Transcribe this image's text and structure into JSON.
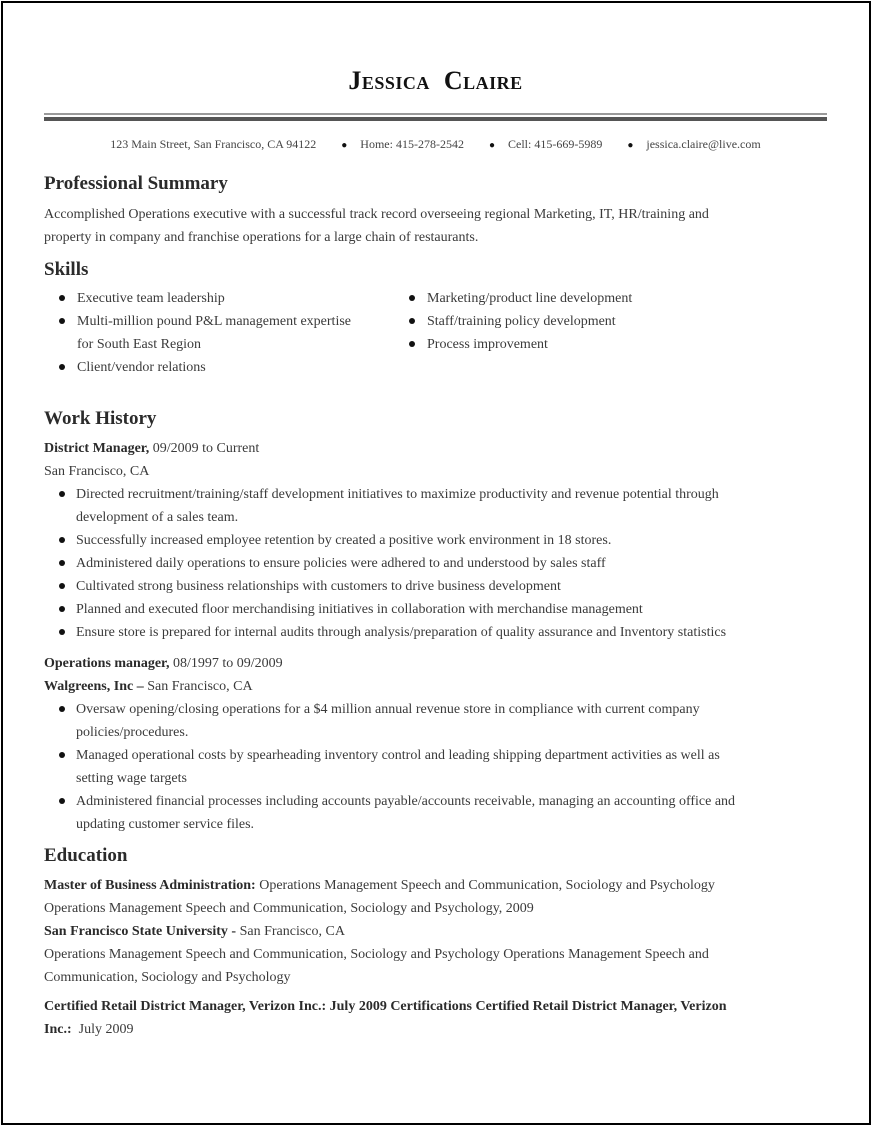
{
  "header": {
    "name": "Jessica  Claire",
    "contact": {
      "address": "123 Main Street, San Francisco, CA 94122",
      "home": "Home: 415-278-2542",
      "cell": "Cell: 415-669-5989",
      "email": "jessica.claire@live.com"
    },
    "bullet_icon": "filled-circle"
  },
  "summary": {
    "title": "Professional Summary",
    "text": "Accomplished Operations executive with a successful track record overseeing regional Marketing, IT, HR/training and property in company and franchise operations for a large chain of restaurants."
  },
  "skills": {
    "title": "Skills",
    "left": [
      "Executive team leadership",
      "Multi-million pound P&L management expertise for South East Region",
      "Client/vendor relations"
    ],
    "right": [
      "Marketing/product line development",
      "Staff/training policy development",
      "Process improvement"
    ]
  },
  "work": {
    "title": "Work History",
    "jobs": [
      {
        "title": "District Manager,",
        "dates": " 09/2009 to Current",
        "company": "",
        "location": "San Francisco, CA",
        "bullets": [
          "Directed recruitment/training/staff development initiatives to maximize productivity and revenue potential through development of a sales team.",
          "Successfully increased employee retention by created a positive work environment in 18 stores.",
          "Administered daily operations to ensure policies were adhered to and understood by sales staff",
          "Cultivated strong business relationships with customers to drive business development",
          "Planned and executed floor merchandising initiatives in collaboration with merchandise management",
          "Ensure store is prepared for internal audits through analysis/preparation of quality assurance and Inventory statistics"
        ]
      },
      {
        "title": "Operations manager,",
        "dates": " 08/1997 to 09/2009",
        "company": "Walgreens, Inc – ",
        "location": " San Francisco, CA",
        "bullets": [
          "Oversaw opening/closing operations for a $4 million annual revenue store in compliance with current company policies/procedures.",
          "Managed operational costs by spearheading inventory control and leading shipping department activities as well as setting wage targets",
          "Administered financial processes including accounts payable/accounts receivable, managing an accounting office and updating customer service files."
        ]
      }
    ]
  },
  "education": {
    "title": "Education",
    "degree": "Master of Business Administration:",
    "degree_detail": " Operations Management Speech and Communication, Sociology and Psychology Operations Management Speech and Communication, Sociology and Psychology, 2009",
    "school": "San Francisco State University -",
    "school_location": " San Francisco, CA",
    "coursework": "Operations Management Speech and Communication, Sociology and Psychology Operations Management Speech and Communication, Sociology and Psychology",
    "certification_bold": "Certified Retail District Manager, Verizon Inc.: July 2009 Certifications Certified Retail District Manager, Verizon Inc.:",
    "certification_date": "  July 2009"
  }
}
